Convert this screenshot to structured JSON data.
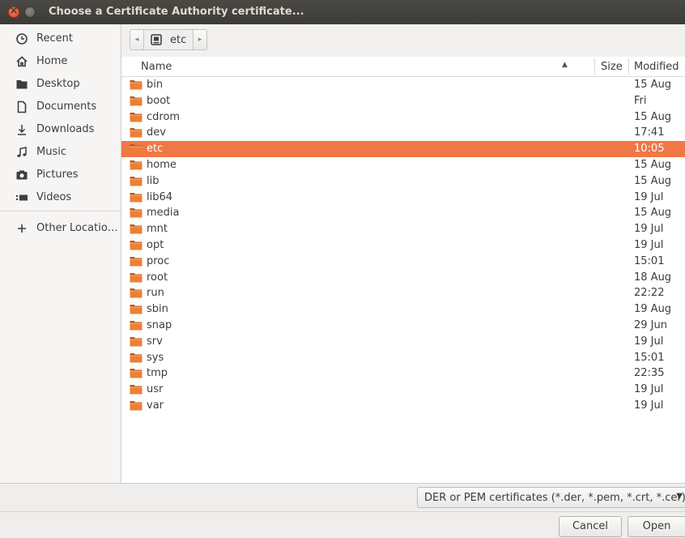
{
  "window": {
    "title": "Choose a Certificate Authority certificate..."
  },
  "sidebar": {
    "items": [
      {
        "label": "Recent",
        "icon": "clock-icon"
      },
      {
        "label": "Home",
        "icon": "home-icon"
      },
      {
        "label": "Desktop",
        "icon": "desktop-folder-icon"
      },
      {
        "label": "Documents",
        "icon": "document-icon"
      },
      {
        "label": "Downloads",
        "icon": "download-icon"
      },
      {
        "label": "Music",
        "icon": "music-icon"
      },
      {
        "label": "Pictures",
        "icon": "camera-icon"
      },
      {
        "label": "Videos",
        "icon": "video-icon"
      }
    ],
    "other_locations": "Other Locations"
  },
  "pathbar": {
    "current": "etc"
  },
  "columns": {
    "name": "Name",
    "size": "Size",
    "modified": "Modified"
  },
  "files": [
    {
      "name": "bin",
      "modified": "15 Aug"
    },
    {
      "name": "boot",
      "modified": "Fri"
    },
    {
      "name": "cdrom",
      "modified": "15 Aug"
    },
    {
      "name": "dev",
      "modified": "17:41"
    },
    {
      "name": "etc",
      "modified": "10:05",
      "selected": true
    },
    {
      "name": "home",
      "modified": "15 Aug"
    },
    {
      "name": "lib",
      "modified": "15 Aug"
    },
    {
      "name": "lib64",
      "modified": "19 Jul"
    },
    {
      "name": "media",
      "modified": "15 Aug"
    },
    {
      "name": "mnt",
      "modified": "19 Jul"
    },
    {
      "name": "opt",
      "modified": "19 Jul"
    },
    {
      "name": "proc",
      "modified": "15:01"
    },
    {
      "name": "root",
      "modified": "18 Aug"
    },
    {
      "name": "run",
      "modified": "22:22"
    },
    {
      "name": "sbin",
      "modified": "19 Aug"
    },
    {
      "name": "snap",
      "modified": "29 Jun"
    },
    {
      "name": "srv",
      "modified": "19 Jul"
    },
    {
      "name": "sys",
      "modified": "15:01"
    },
    {
      "name": "tmp",
      "modified": "22:35"
    },
    {
      "name": "usr",
      "modified": "19 Jul"
    },
    {
      "name": "var",
      "modified": "19 Jul"
    }
  ],
  "filter": {
    "selected": "DER or PEM certificates (*.der, *.pem, *.crt, *.cer)"
  },
  "buttons": {
    "cancel": "Cancel",
    "open": "Open"
  },
  "colors": {
    "selection": "#f07746",
    "folder": "#e8762d",
    "titlebar": "#3c3b37"
  }
}
